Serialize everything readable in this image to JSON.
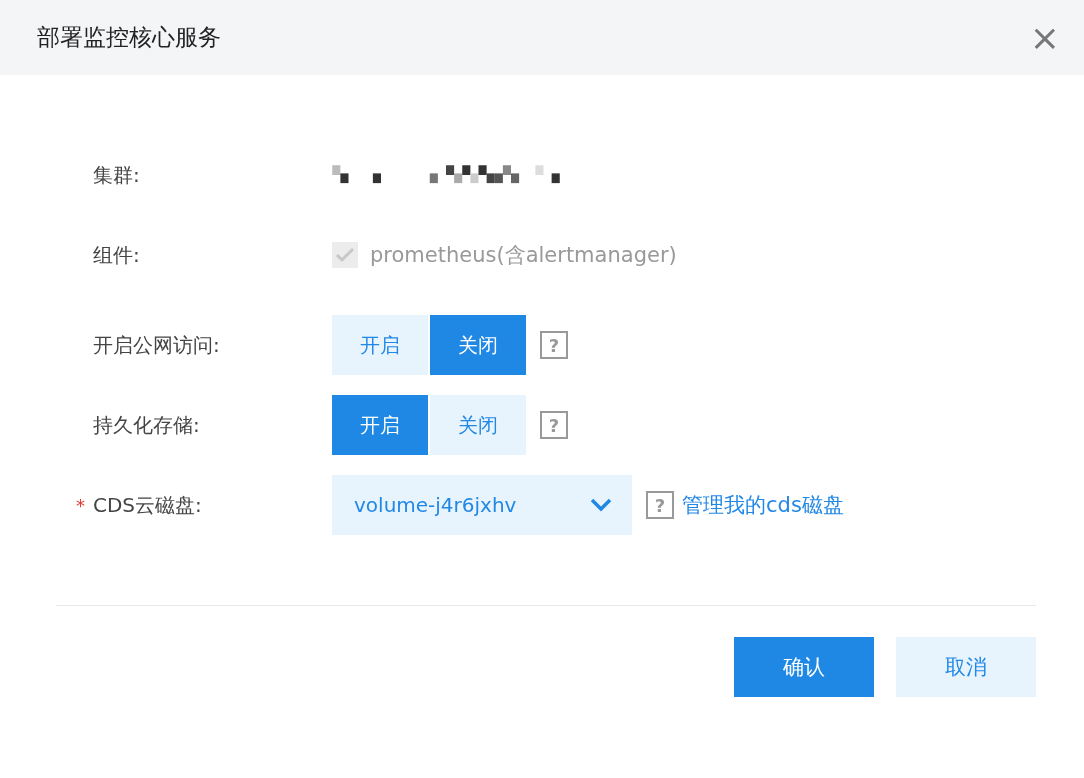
{
  "dialog": {
    "title": "部署监控核心服务",
    "close": "×"
  },
  "fields": [
    {
      "kind": "redacted",
      "label": "集群:"
    },
    {
      "kind": "checkbox",
      "label": "组件:",
      "checked": true,
      "disabled": true,
      "text": "prometheus(含alertmanager)"
    },
    {
      "kind": "toggle",
      "label": "开启公网访问:",
      "options": [
        {
          "label": "开启",
          "selected": false
        },
        {
          "label": "关闭",
          "selected": true
        }
      ],
      "help": "?"
    },
    {
      "kind": "toggle",
      "label": "持久化存储:",
      "options": [
        {
          "label": "开启",
          "selected": true
        },
        {
          "label": "关闭",
          "selected": false
        }
      ],
      "help": "?"
    },
    {
      "kind": "select",
      "label": "CDS云磁盘:",
      "required_mark": "*",
      "value": "volume-j4r6jxhv",
      "help": "?",
      "link": "管理我的cds磁盘"
    }
  ],
  "buttons": [
    {
      "label": "确认",
      "kind": "primary"
    },
    {
      "label": "取消",
      "kind": "secondary"
    }
  ]
}
